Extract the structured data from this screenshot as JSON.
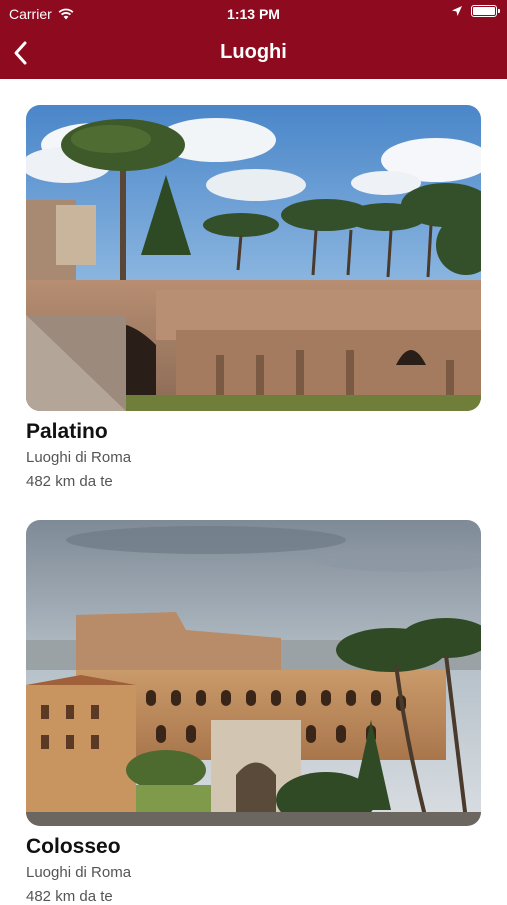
{
  "status_bar": {
    "carrier": "Carrier",
    "time": "1:13 PM",
    "icons": [
      "wifi-icon",
      "location-arrow-icon",
      "battery-icon"
    ]
  },
  "nav": {
    "title": "Luoghi",
    "back_icon": "chevron-left-icon"
  },
  "places": [
    {
      "name": "Palatino",
      "category": "Luoghi di Roma",
      "distance": "482 km da te"
    },
    {
      "name": "Colosseo",
      "category": "Luoghi di Roma",
      "distance": "482 km da te"
    }
  ],
  "colors": {
    "header_bg": "#8e0a1f",
    "header_text": "#ffffff"
  }
}
